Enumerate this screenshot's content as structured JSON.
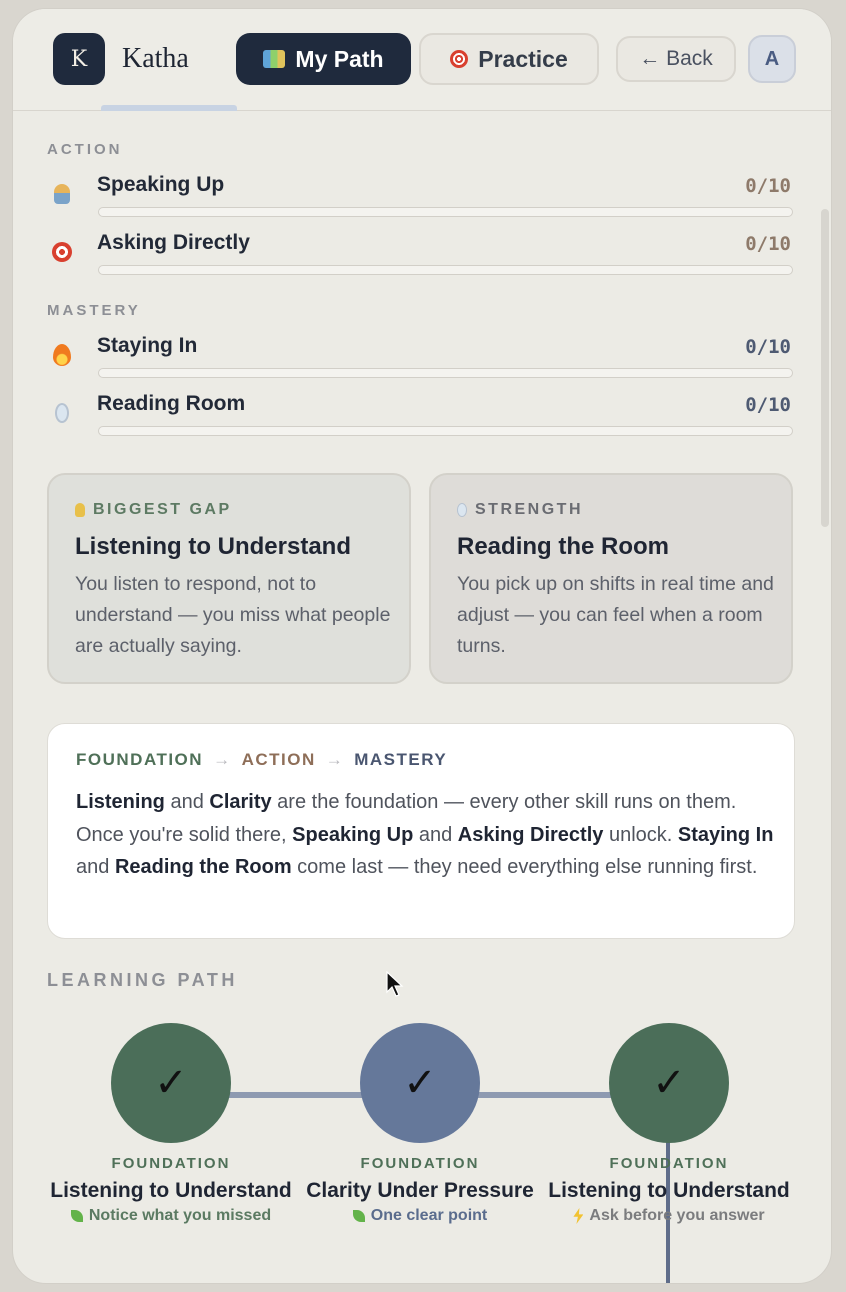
{
  "header": {
    "logo_letter": "K",
    "app_name": "Katha",
    "nav": {
      "my_path": "My Path",
      "practice": "Practice",
      "back": "← Back",
      "avatar": "A"
    }
  },
  "sections": {
    "action_label": "ACTION",
    "mastery_label": "MASTERY"
  },
  "skills": [
    {
      "name": "Speaking Up",
      "score": "0/10",
      "progress": 0,
      "icon": "person-raising-hand-icon",
      "score_color": "#8e7a6a"
    },
    {
      "name": "Asking Directly",
      "score": "0/10",
      "progress": 0,
      "icon": "target-icon",
      "score_color": "#8e7a6a"
    },
    {
      "name": "Staying In",
      "score": "0/10",
      "progress": 0,
      "icon": "fire-icon",
      "score_color": "#4e5a72"
    },
    {
      "name": "Reading Room",
      "score": "0/10",
      "progress": 0,
      "icon": "mirror-icon",
      "score_color": "#4e5a72"
    }
  ],
  "cards": {
    "gap": {
      "kicker": "BIGGEST GAP",
      "title": "Listening to Understand",
      "body": "You listen to respond, not to understand — you miss what people are actually saying."
    },
    "strength": {
      "kicker": "STRENGTH",
      "title": "Reading the Room",
      "body": "You pick up on shifts in real time and adjust — you can feel when a room turns."
    }
  },
  "progression": {
    "foundation": "FOUNDATION",
    "action": "ACTION",
    "mastery": "MASTERY",
    "arrow": "→",
    "t1": "Listening",
    "t2": " and ",
    "t3": "Clarity",
    "t4": " are the foundation — every other skill runs on them. Once you're solid there, ",
    "t5": "Speaking Up",
    "t6": " and ",
    "t7": "Asking Directly",
    "t8": " unlock. ",
    "t9": "Staying In",
    "t10": " and ",
    "t11": "Reading the Room",
    "t12": " come last — they need everything else running first."
  },
  "learning_path": {
    "label": "LEARNING PATH",
    "check": "✓",
    "nodes": [
      {
        "category": "FOUNDATION",
        "name": "Listening to Understand",
        "hint": "Notice what you missed",
        "state": "complete"
      },
      {
        "category": "FOUNDATION",
        "name": "Clarity Under Pressure",
        "hint": "One clear point",
        "state": "complete"
      },
      {
        "category": "FOUNDATION",
        "name": "Listening to Understand",
        "hint": "Ask before you answer",
        "state": "complete"
      }
    ]
  }
}
